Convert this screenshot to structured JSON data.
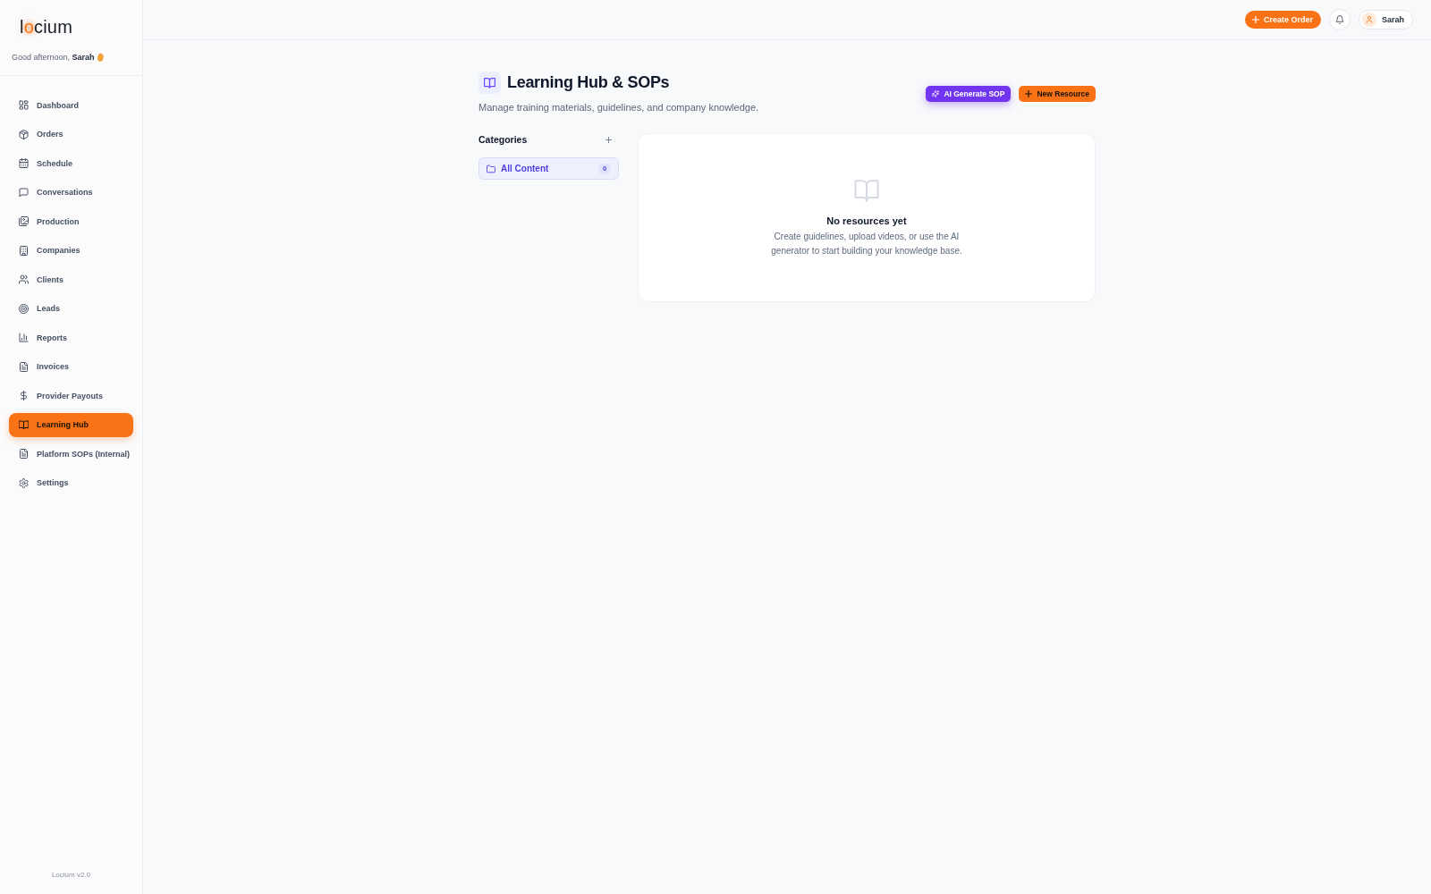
{
  "sidebar": {
    "logo": "locium",
    "greeting": "Good afternoon, **Sarah**",
    "nav": [
      {
        "label": "Dashboard",
        "selected": false
      },
      {
        "label": "Orders",
        "selected": false
      },
      {
        "label": "Schedule",
        "selected": false
      },
      {
        "label": "Conversations",
        "selected": false
      },
      {
        "label": "Production",
        "selected": false
      },
      {
        "label": "Companies",
        "selected": false
      },
      {
        "label": "Clients",
        "selected": false
      },
      {
        "label": "Leads",
        "selected": false
      },
      {
        "label": "Reports",
        "selected": false
      },
      {
        "label": "Invoices",
        "selected": false
      },
      {
        "label": "Provider Payouts",
        "selected": false
      },
      {
        "label": "Learning Hub",
        "selected": true
      },
      {
        "label": "Platform SOPs (Internal)",
        "selected": false
      },
      {
        "label": "Settings",
        "selected": false
      }
    ],
    "version": "Locium v2.0"
  },
  "topbar": {
    "create_button": "Create Order",
    "user": "Sarah"
  },
  "page": {
    "title": "Learning Hub & SOPs",
    "subtitle": "Manage training materials, guidelines, and company knowledge.",
    "actions": [
      {
        "kind": "ai",
        "label": "AI Generate SOP"
      },
      {
        "kind": "primary",
        "label": "New Resource"
      }
    ]
  },
  "categories": {
    "title": "Categories",
    "items": [
      {
        "label": "All Content",
        "count": "0",
        "selected": true
      }
    ]
  },
  "empty_state": {
    "title": "No resources yet",
    "text": "Create guidelines, upload videos, or use the AI generator to start building your knowledge base."
  }
}
